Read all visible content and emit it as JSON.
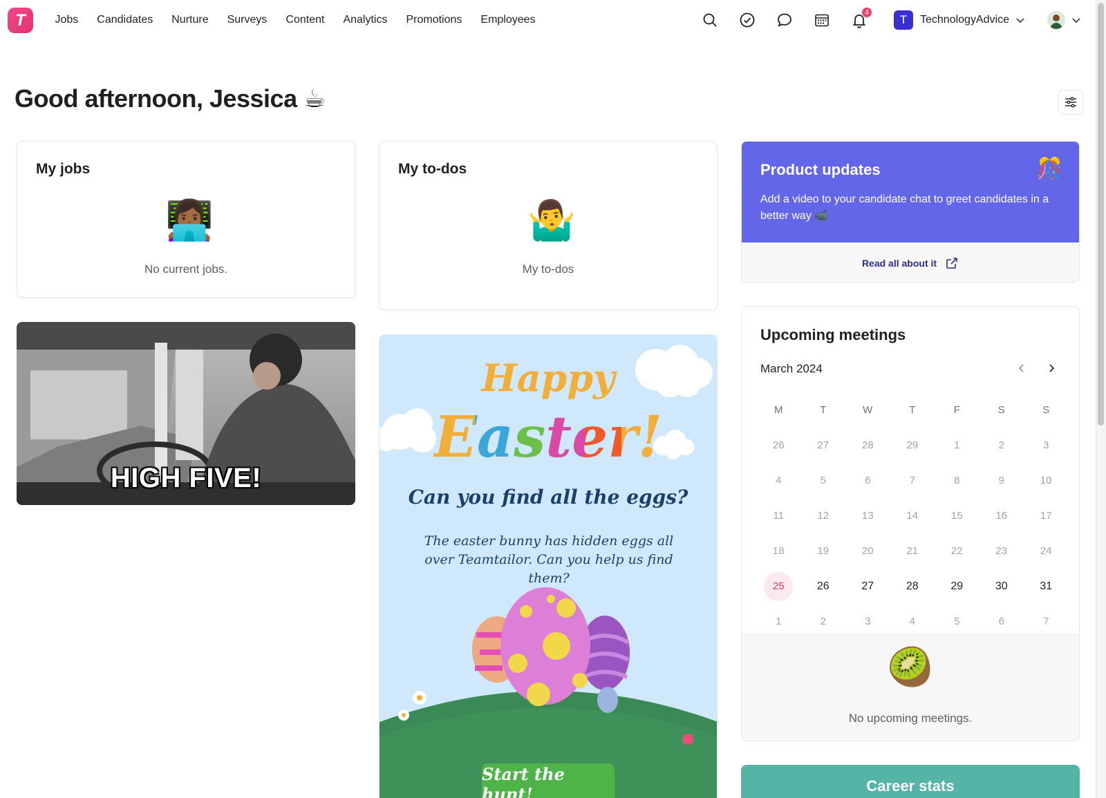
{
  "nav": {
    "logo": "T",
    "items": [
      "Jobs",
      "Candidates",
      "Nurture",
      "Surveys",
      "Content",
      "Analytics",
      "Promotions",
      "Employees"
    ],
    "icons": [
      "search-icon",
      "check-circle-icon",
      "chat-icon",
      "calendar-icon",
      "bell-icon"
    ],
    "notification_count": "4",
    "company_initial": "T",
    "company_name": "TechnologyAdvice"
  },
  "greeting": "Good afternoon, Jessica ☕",
  "my_jobs": {
    "title": "My jobs",
    "emoji": "👩🏾‍💻",
    "empty_text": "No current jobs."
  },
  "my_todos": {
    "title": "My to-dos",
    "emoji": "🤷‍♂️",
    "empty_text": "My to-dos"
  },
  "gif": {
    "caption": "HIGH FIVE!"
  },
  "easter": {
    "happy": "Happy",
    "easter": "Easter!",
    "question": "Can you find all the eggs?",
    "subtitle": "The easter bunny has hidden eggs all over Teamtailor. Can you help us find them?",
    "button": "Start the hunt!"
  },
  "product_updates": {
    "title": "Product updates",
    "emoji": "🎊",
    "text": "Add a video to your candidate chat to greet candidates in a better way 📹",
    "link": "Read all about it"
  },
  "meetings": {
    "title": "Upcoming meetings",
    "month": "March 2024",
    "weekdays": [
      "M",
      "T",
      "W",
      "T",
      "F",
      "S",
      "S"
    ],
    "weeks": [
      [
        {
          "d": "26",
          "s": "muted"
        },
        {
          "d": "27",
          "s": "muted"
        },
        {
          "d": "28",
          "s": "muted"
        },
        {
          "d": "29",
          "s": "muted"
        },
        {
          "d": "1",
          "s": "muted"
        },
        {
          "d": "2",
          "s": "muted"
        },
        {
          "d": "3",
          "s": "muted"
        }
      ],
      [
        {
          "d": "4",
          "s": "muted"
        },
        {
          "d": "5",
          "s": "muted"
        },
        {
          "d": "6",
          "s": "muted"
        },
        {
          "d": "7",
          "s": "muted"
        },
        {
          "d": "8",
          "s": "muted"
        },
        {
          "d": "9",
          "s": "muted"
        },
        {
          "d": "10",
          "s": "muted"
        }
      ],
      [
        {
          "d": "11",
          "s": "muted"
        },
        {
          "d": "12",
          "s": "muted"
        },
        {
          "d": "13",
          "s": "muted"
        },
        {
          "d": "14",
          "s": "muted"
        },
        {
          "d": "15",
          "s": "muted"
        },
        {
          "d": "16",
          "s": "muted"
        },
        {
          "d": "17",
          "s": "muted"
        }
      ],
      [
        {
          "d": "18",
          "s": "muted"
        },
        {
          "d": "19",
          "s": "muted"
        },
        {
          "d": "20",
          "s": "muted"
        },
        {
          "d": "21",
          "s": "muted"
        },
        {
          "d": "22",
          "s": "muted"
        },
        {
          "d": "23",
          "s": "muted"
        },
        {
          "d": "24",
          "s": "muted"
        }
      ],
      [
        {
          "d": "25",
          "s": "today"
        },
        {
          "d": "26",
          "s": "current"
        },
        {
          "d": "27",
          "s": "current"
        },
        {
          "d": "28",
          "s": "current"
        },
        {
          "d": "29",
          "s": "current"
        },
        {
          "d": "30",
          "s": "current"
        },
        {
          "d": "31",
          "s": "current"
        }
      ],
      [
        {
          "d": "1",
          "s": "muted"
        },
        {
          "d": "2",
          "s": "muted"
        },
        {
          "d": "3",
          "s": "muted"
        },
        {
          "d": "4",
          "s": "muted"
        },
        {
          "d": "5",
          "s": "muted"
        },
        {
          "d": "6",
          "s": "muted"
        },
        {
          "d": "7",
          "s": "muted"
        }
      ]
    ],
    "empty_emoji": "🥝",
    "empty_text": "No upcoming meetings."
  },
  "career_stats": {
    "title": "Career stats"
  },
  "colors": {
    "accent": "#6366e8",
    "brand": "#e2336f",
    "career": "#54b5a6",
    "today": "#d43a6a"
  }
}
